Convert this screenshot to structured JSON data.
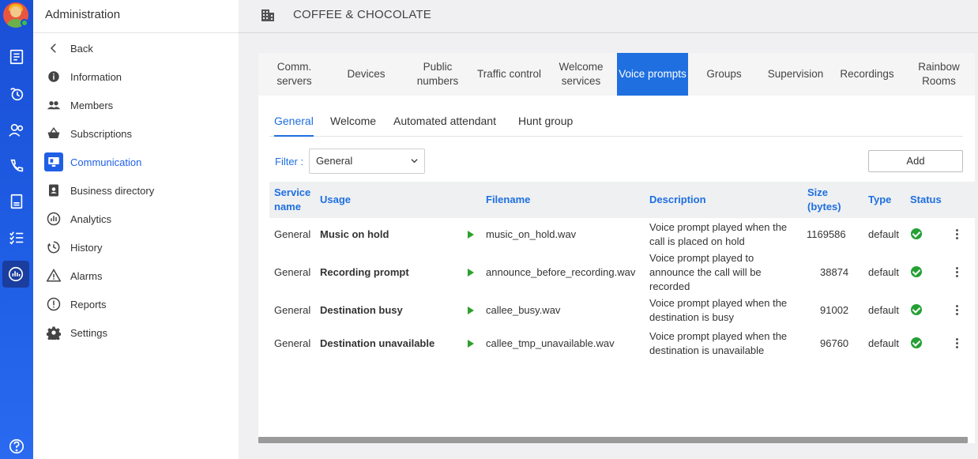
{
  "app": {
    "panel_title": "Administration"
  },
  "header": {
    "company": "COFFEE & CHOCOLATE"
  },
  "menu": [
    {
      "label": "Back",
      "icon": "chevron-left-icon"
    },
    {
      "label": "Information",
      "icon": "info-icon"
    },
    {
      "label": "Members",
      "icon": "members-icon"
    },
    {
      "label": "Subscriptions",
      "icon": "basket-icon"
    },
    {
      "label": "Communication",
      "icon": "communication-icon",
      "active": true
    },
    {
      "label": "Business directory",
      "icon": "directory-icon"
    },
    {
      "label": "Analytics",
      "icon": "analytics-icon"
    },
    {
      "label": "History",
      "icon": "history-icon"
    },
    {
      "label": "Alarms",
      "icon": "alarm-icon"
    },
    {
      "label": "Reports",
      "icon": "report-icon"
    },
    {
      "label": "Settings",
      "icon": "gear-icon"
    }
  ],
  "tabs": [
    {
      "label": "Comm. servers"
    },
    {
      "label": "Devices"
    },
    {
      "label": "Public numbers"
    },
    {
      "label": "Traffic control"
    },
    {
      "label": "Welcome services"
    },
    {
      "label": "Voice prompts",
      "active": true
    },
    {
      "label": "Groups"
    },
    {
      "label": "Supervision"
    },
    {
      "label": "Recordings"
    },
    {
      "label": "Rainbow Rooms"
    }
  ],
  "subtabs": [
    {
      "label": "General",
      "active": true
    },
    {
      "label": "Welcome"
    },
    {
      "label": "Automated attendant"
    },
    {
      "label": "Hunt group"
    }
  ],
  "filter": {
    "label": "Filter :",
    "value": "General"
  },
  "add_label": "Add",
  "table": {
    "headers": {
      "service_name": "Service name",
      "usage": "Usage",
      "filename": "Filename",
      "description": "Description",
      "size": "Size (bytes)",
      "type": "Type",
      "status": "Status"
    },
    "rows": [
      {
        "service": "General",
        "usage": "Music on hold",
        "filename": "music_on_hold.wav",
        "description": "Voice prompt played when the call is placed on hold",
        "size": "1169586",
        "type": "default"
      },
      {
        "service": "General",
        "usage": "Recording prompt",
        "filename": "announce_before_recording.wav",
        "description": "Voice prompt played to announce the call will be recorded",
        "size": "38874",
        "type": "default"
      },
      {
        "service": "General",
        "usage": "Destination busy",
        "filename": "callee_busy.wav",
        "description": "Voice prompt played when the destination is busy",
        "size": "91002",
        "type": "default"
      },
      {
        "service": "General",
        "usage": "Destination unavailable",
        "filename": "callee_tmp_unavailable.wav",
        "description": "Voice prompt played when the destination is unavailable",
        "size": "96760",
        "type": "default"
      }
    ]
  },
  "colors": {
    "accent": "#1f6fe0",
    "rail": "#1a4fd6",
    "status_ok": "#25a035"
  }
}
